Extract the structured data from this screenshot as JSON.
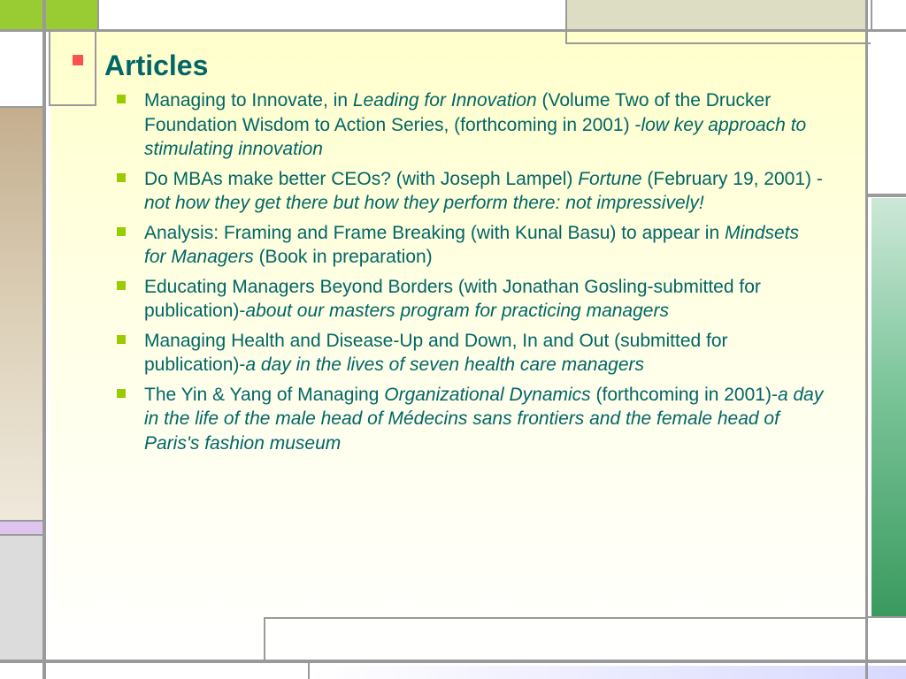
{
  "slide": {
    "title": "Articles",
    "items": [
      {
        "plain": "Managing to Innovate, in ",
        "em1": "Leading for Innovation",
        "plain2": " (Volume Two of the Drucker Foundation Wisdom to Action Series, (forthcoming in 2001) -",
        "em2": "low key approach to stimulating innovation"
      },
      {
        "plain": "Do MBAs make better CEOs? (with Joseph Lampel) ",
        "em1": "Fortune",
        "plain2": " (February 19, 2001) -",
        "em2": "not how they get there but how they perform there: not impressively!"
      },
      {
        "plain": "Analysis: Framing and Frame Breaking (with Kunal Basu) to appear in ",
        "em1": "Mindsets for Managers",
        "plain2": " (Book in preparation)",
        "em2": ""
      },
      {
        "plain": "Educating Managers Beyond Borders (with Jonathan Gosling-submitted for publication)-",
        "em1": "about our masters program for practicing managers",
        "plain2": "",
        "em2": ""
      },
      {
        "plain": "Managing Health and Disease-Up and Down, In and Out (submitted for publication)-",
        "em1": "a day in the lives of seven health care managers",
        "plain2": "",
        "em2": ""
      },
      {
        "plain": "The Yin & Yang of Managing ",
        "em1": "Organizational Dynamics",
        "plain2": " (forthcoming in 2001)-",
        "em2": "a day in the life of the male head of Médecins sans frontiers and the female head of Paris's fashion museum"
      }
    ]
  },
  "colors": {
    "title": "#006666",
    "title_bullet": "#ff5050",
    "item_bullet": "#99cc00",
    "grid_line": "#9a9a9a"
  }
}
